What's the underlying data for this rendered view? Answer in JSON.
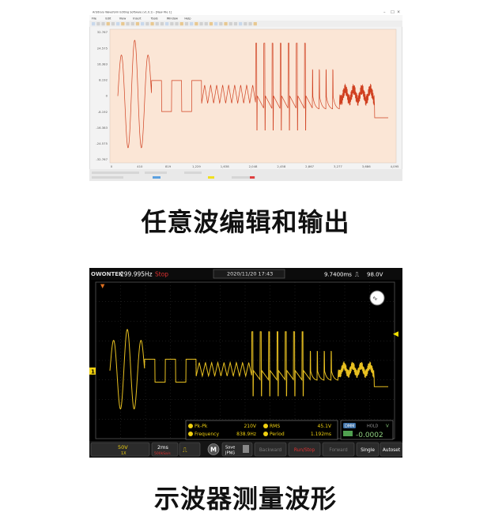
{
  "captions": {
    "top": "任意波编辑和输出",
    "bottom": "示波器测量波形"
  },
  "editor": {
    "title_bar": "Arbitrary Waveform Editing Software (v1.0.1) - [New File 1]",
    "menu": [
      "File",
      "Edit",
      "View",
      "Insert",
      "Tools",
      "Window",
      "Help"
    ],
    "y_ticks": [
      "32.767",
      "24.575",
      "16.383",
      "8.192",
      "0",
      "-8.192",
      "-16.383",
      "-24.575",
      "-32.767"
    ],
    "x_ticks": [
      "0",
      "410",
      "819",
      "1,229",
      "1,638",
      "2,048",
      "2,458",
      "2,867",
      "3,277",
      "3,686",
      "4,095"
    ],
    "plot_bg": "#fbe6d6",
    "trace_color": "#d04020"
  },
  "scope": {
    "brand": "OWON",
    "brand_tail": "TEK",
    "frequency": "299.995Hz",
    "run_state": "Stop",
    "datetime": "2020/11/20  17:43",
    "trigger_time": "9.7400ms",
    "trigger_level": "98.0V",
    "channel_marker": "1",
    "measurements": [
      {
        "label": "Pk-Pk",
        "value": "210V"
      },
      {
        "label": "RMS",
        "value": "45.1V"
      },
      {
        "label": "Frequency",
        "value": "838.9Hz"
      },
      {
        "label": "Period",
        "value": "1.192ms"
      }
    ],
    "meter_label": "DMM",
    "meter_hold": "HOLD",
    "meter_unit": "V",
    "meter_value": "-0.0002",
    "soft_buttons": {
      "ch_scale": "50V",
      "ch_probe": "1X",
      "timebase": "2ms",
      "sample_rate": "500kSa/s",
      "menu": "M",
      "save_top": "Save",
      "save_bottom": "JPNG",
      "backward": "Backward",
      "run_stop": "Run/Stop",
      "forward": "Forward",
      "single": "Single",
      "autoset": "Autoset"
    },
    "colors": {
      "trace": "#e8c020",
      "grid": "#3a3a3a",
      "frame": "#2a2a2a"
    }
  }
}
